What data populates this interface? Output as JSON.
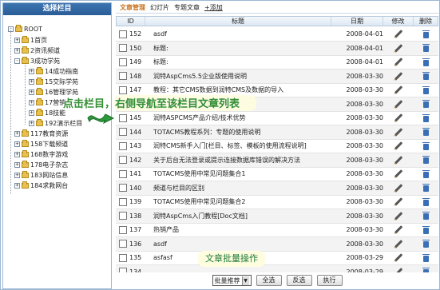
{
  "sidebar": {
    "title": "选择栏目",
    "root": "ROOT",
    "items": [
      {
        "label": "1首页",
        "level": 1,
        "state": "+"
      },
      {
        "label": "2资讯频道",
        "level": 1,
        "state": "+"
      },
      {
        "label": "3成功学苑",
        "level": 1,
        "state": "-"
      },
      {
        "label": "14成功指南",
        "level": 2,
        "state": "+"
      },
      {
        "label": "15交际学苑",
        "level": 2,
        "state": "+"
      },
      {
        "label": "16管理学苑",
        "level": 2,
        "state": "+"
      },
      {
        "label": "17营销",
        "level": 2,
        "state": "+"
      },
      {
        "label": "18技能",
        "level": 2,
        "state": "+"
      },
      {
        "label": "192演示栏目",
        "level": 2,
        "state": "+"
      },
      {
        "label": "117教育资源",
        "level": 1,
        "state": "+"
      },
      {
        "label": "158下载频道",
        "level": 1,
        "state": "+"
      },
      {
        "label": "168数字游戏",
        "level": 1,
        "state": "+"
      },
      {
        "label": "178电子杂志",
        "level": 1,
        "state": "+"
      },
      {
        "label": "183网站信息",
        "level": 1,
        "state": "+"
      },
      {
        "label": "184求救网台",
        "level": 1,
        "state": "+"
      }
    ]
  },
  "tabs": [
    {
      "label": "文章管理",
      "active": true
    },
    {
      "label": "幻灯片",
      "active": false
    },
    {
      "label": "专题文章",
      "active": false
    },
    {
      "label": "+添加",
      "active": false
    }
  ],
  "table": {
    "headers": [
      "ID",
      "标题",
      "日期",
      "修改",
      "删除"
    ],
    "rows": [
      {
        "id": "152",
        "title": "asdf",
        "date": "2008-04-01"
      },
      {
        "id": "150",
        "title": "标题:",
        "date": "2008-04-01"
      },
      {
        "id": "149",
        "title": "标题:",
        "date": "2008-04-01"
      },
      {
        "id": "148",
        "title": "润特AspCms5.5企业版使用说明",
        "date": "2008-03-30"
      },
      {
        "id": "147",
        "title": "教程：其它CMS数据到润特CMS及数据的导入",
        "date": "2008-03-30"
      },
      {
        "id": "146",
        "title": "AspCms实用问题集锦解决",
        "date": "2008-03-30"
      },
      {
        "id": "145",
        "title": "润特ASPCMS产品介绍/技术优势",
        "date": "2008-03-30"
      },
      {
        "id": "144",
        "title": "TOTACMS教程系列：专题的使用说明",
        "date": "2008-03-30"
      },
      {
        "id": "143",
        "title": "润特CMS新手入门[栏目、标签、模板的使用流程说明]",
        "date": "2008-03-30"
      },
      {
        "id": "142",
        "title": "关于后台无法登录或提示连接数据库错误的解决方法",
        "date": "2008-03-30"
      },
      {
        "id": "141",
        "title": "TOTACMS使用中常见问题集合1",
        "date": "2008-03-30"
      },
      {
        "id": "140",
        "title": "频道与栏目的区别",
        "date": "2008-03-30"
      },
      {
        "id": "139",
        "title": "TOTACMS使用中常见问题集合2",
        "date": "2008-03-30"
      },
      {
        "id": "138",
        "title": "润特AspCms入门教程[Doc文档]",
        "date": "2008-03-30"
      },
      {
        "id": "137",
        "title": "热销产品",
        "date": "2008-03-30"
      },
      {
        "id": "136",
        "title": "asdf",
        "date": "2008-03-30"
      },
      {
        "id": "135",
        "title": "asfasf",
        "date": "2008-03-29"
      },
      {
        "id": "134",
        "title": "",
        "date": "2008-03-29"
      }
    ]
  },
  "bottom": {
    "select_value": "批量推荐",
    "select_all": "全选",
    "invert": "反选",
    "execute": "执行"
  },
  "annotations": {
    "tree_tip": "点击栏目，右侧导航至该栏目文章列表",
    "batch_tip": "文章批量操作"
  },
  "colors": {
    "accent": "#c8731f",
    "header": "#2a5d97",
    "annotation_text": "#2a8a2a"
  }
}
